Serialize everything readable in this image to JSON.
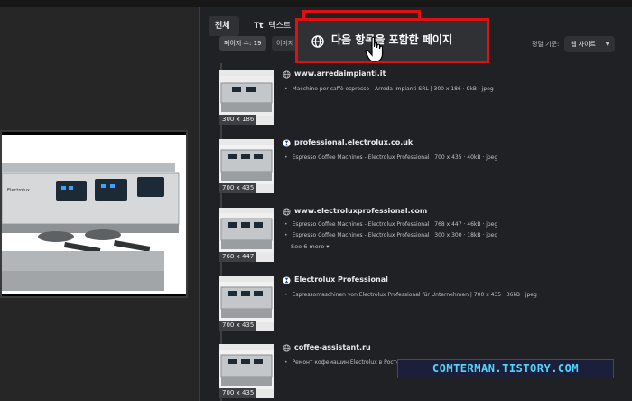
{
  "tabs": {
    "all": "전체",
    "text_icon": "Tt",
    "text": "텍스트"
  },
  "filters": {
    "page_count": "페이지 수: 19",
    "image": "이미지"
  },
  "sort": {
    "label": "정렬 기준:",
    "value": "웹 사이트"
  },
  "highlight": {
    "label": "다음 항목을 포함한 페이지",
    "color": "#e01010"
  },
  "results": [
    {
      "domain": "www.arredaimpianti.it",
      "icon": "globe-icon",
      "size": "300 x 186",
      "lines": [
        "Macchine per caffè espresso - Arreda Impianti SRL | 300 x 186 · 9kB · jpeg"
      ]
    },
    {
      "domain": "professional.electrolux.co.uk",
      "icon": "electrolux-logo-icon",
      "size": "700 x 435",
      "lines": [
        "Espresso Coffee Machines - Electrolux Professional | 700 x 435 · 40kB · jpeg"
      ]
    },
    {
      "domain": "www.electroluxprofessional.com",
      "icon": "globe-icon",
      "size": "768 x 447",
      "lines": [
        "Espresso Coffee Machines - Electrolux Professional | 768 x 447 · 46kB · jpeg",
        "Espresso Coffee Machines - Electrolux Professional | 300 x 300 · 18kB · jpeg"
      ],
      "see_more": "See 6 more ▾"
    },
    {
      "domain": "Electrolux Professional",
      "icon": "electrolux-logo-icon",
      "size": "700 x 435",
      "lines": [
        "Espressomaschinen von Electrolux Professional für Unternehmen | 700 x 435 · 36kB · jpeg"
      ]
    },
    {
      "domain": "coffee-assistant.ru",
      "icon": "globe-icon",
      "size": "700 x 435",
      "lines": [
        "Ремонт кофемашин Electrolux в Ростове-на-Дону | Coffee... | 700 x 435 · 111kB · jpeg"
      ]
    }
  ],
  "watermark": "COMTERMAN.TISTORY.COM"
}
